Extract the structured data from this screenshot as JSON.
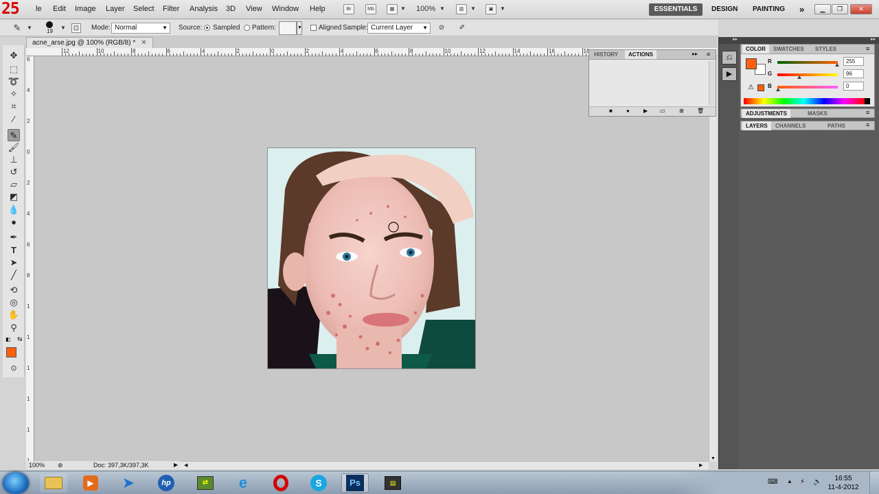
{
  "overlay": {
    "counter": "25"
  },
  "menubar": {
    "items": [
      "le",
      "Edit",
      "Image",
      "Layer",
      "Select",
      "Filter",
      "Analysis",
      "3D",
      "View",
      "Window",
      "Help"
    ],
    "zoom": "100%",
    "workspaces": [
      "ESSENTIALS",
      "DESIGN",
      "PAINTING",
      "»"
    ],
    "icons": [
      "bridge-icon",
      "minibridge-icon",
      "view-extras-icon",
      "arrange-documents-icon",
      "screen-mode-icon"
    ]
  },
  "options": {
    "brush_size": "19",
    "mode_label": "Mode:",
    "mode_value": "Normal",
    "source_label": "Source:",
    "sampled_label": "Sampled",
    "pattern_label": "Pattern:",
    "aligned_label": "Aligned",
    "sample_label": "Sample:",
    "sample_value": "Current Layer"
  },
  "document": {
    "tab_title": "acne_arse.jpg @ 100% (RGB/8) *",
    "ruler_h_labels": [
      "12",
      "10",
      "8",
      "6",
      "4",
      "2",
      "0",
      "2",
      "4",
      "6",
      "8",
      "10",
      "12",
      "14",
      "16",
      "18"
    ],
    "ruler_v_labels": [
      "6",
      "4",
      "2",
      "0",
      "2",
      "4",
      "6",
      "8",
      "1",
      "1",
      "1",
      "1",
      "1",
      "1"
    ],
    "zoom_status": "100%",
    "doc_info": "Doc: 397,3K/397,3K"
  },
  "history_panel": {
    "tabs": [
      "HISTORY",
      "ACTIONS"
    ]
  },
  "color_panel": {
    "tabs": [
      "COLOR",
      "SWATCHES",
      "STYLES"
    ],
    "channels": [
      {
        "label": "R",
        "value": "255"
      },
      {
        "label": "G",
        "value": "96"
      },
      {
        "label": "B",
        "value": "0"
      }
    ],
    "foreground": "#ff6010",
    "background": "#ffffff"
  },
  "adjustments_panel": {
    "tabs": [
      "ADJUSTMENTS",
      "MASKS"
    ]
  },
  "layers_panel": {
    "tabs": [
      "LAYERS",
      "CHANNELS",
      "PATHS"
    ]
  },
  "taskbar": {
    "apps": [
      "explorer",
      "media-player",
      "arrow-app",
      "hp",
      "utility",
      "internet-explorer",
      "opera",
      "skype",
      "photoshop",
      "terminal"
    ],
    "ps_label": "Ps",
    "time": "16:55",
    "date": "11-4-2012"
  }
}
